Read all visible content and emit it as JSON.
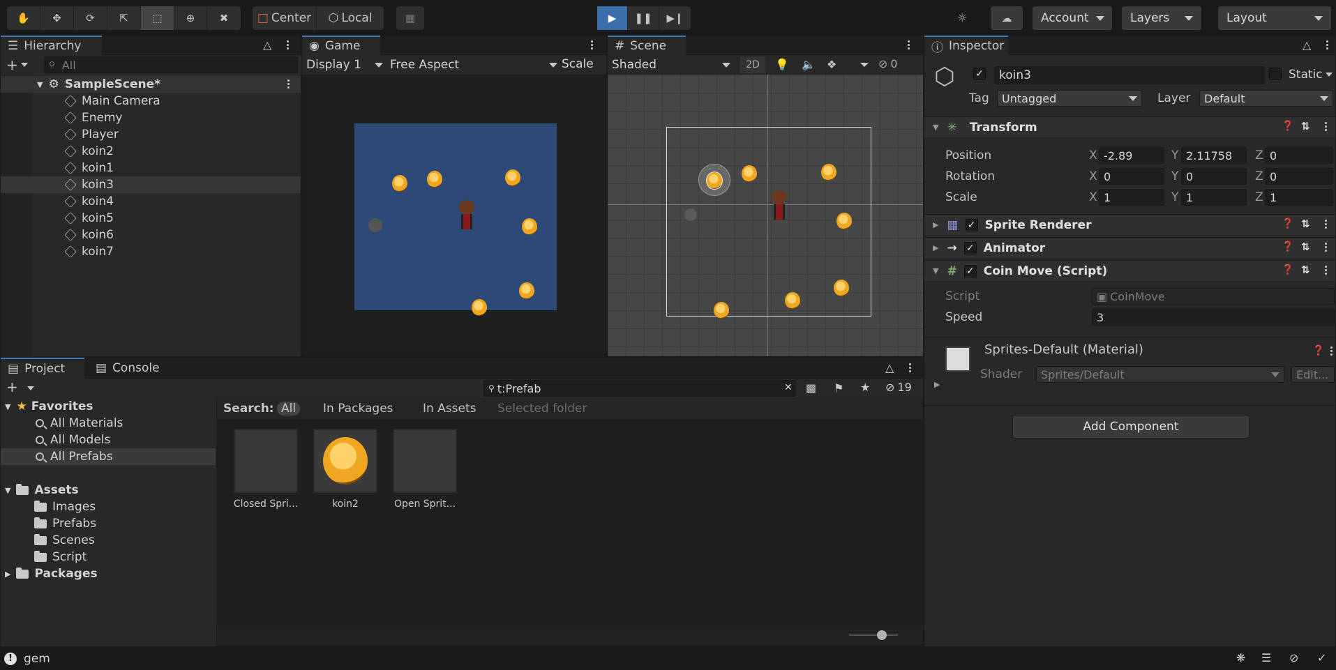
{
  "toolbar": {
    "pivot": "Center",
    "space": "Local",
    "account": "Account",
    "layers": "Layers",
    "layout": "Layout"
  },
  "hierarchy": {
    "tab": "Hierarchy",
    "search_placeholder": "All",
    "scene": "SampleScene*",
    "items": [
      "Main Camera",
      "Enemy",
      "Player",
      "koin2",
      "koin1",
      "koin3",
      "koin4",
      "koin5",
      "koin6",
      "koin7"
    ],
    "selected_index": 5
  },
  "game": {
    "tab": "Game",
    "display": "Display 1",
    "aspect": "Free Aspect",
    "scale": "Scale"
  },
  "scene_view": {
    "tab": "Scene",
    "shading": "Shaded",
    "mode_2d": "2D",
    "hidden_count": "0"
  },
  "inspector": {
    "tab": "Inspector",
    "object_name": "koin3",
    "static_label": "Static",
    "tag_label": "Tag",
    "tag_value": "Untagged",
    "layer_label": "Layer",
    "layer_value": "Default",
    "transform": {
      "title": "Transform",
      "position_label": "Position",
      "rotation_label": "Rotation",
      "scale_label": "Scale",
      "position": {
        "x": "-2.89",
        "y": "2.11758",
        "z": "0"
      },
      "rotation": {
        "x": "0",
        "y": "0",
        "z": "0"
      },
      "scale": {
        "x": "1",
        "y": "1",
        "z": "1"
      }
    },
    "sprite_renderer": "Sprite Renderer",
    "animator": "Animator",
    "coin_move": {
      "title": "Coin Move (Script)",
      "script_label": "Script",
      "script_value": "CoinMove",
      "speed_label": "Speed",
      "speed_value": "3"
    },
    "material": {
      "name": "Sprites-Default (Material)",
      "shader_label": "Shader",
      "shader_value": "Sprites/Default",
      "edit": "Edit..."
    },
    "add_component": "Add Component"
  },
  "project": {
    "tab_project": "Project",
    "tab_console": "Console",
    "search_value": "t:Prefab",
    "hidden_count": "19",
    "search_label": "Search:",
    "filters": [
      "All",
      "In Packages",
      "In Assets",
      "Selected folder"
    ],
    "favorites_label": "Favorites",
    "favorites": [
      "All Materials",
      "All Models",
      "All Prefabs"
    ],
    "assets_label": "Assets",
    "assets": [
      "Images",
      "Prefabs",
      "Scenes",
      "Script"
    ],
    "packages_label": "Packages",
    "grid_items": [
      "Closed Spri...",
      "koin2",
      "Open Sprit..."
    ]
  },
  "status": {
    "message": "gem"
  },
  "colors": {
    "accent": "#3a79bb",
    "game_bg": "#2d4a76",
    "coin": "#f0a620"
  }
}
